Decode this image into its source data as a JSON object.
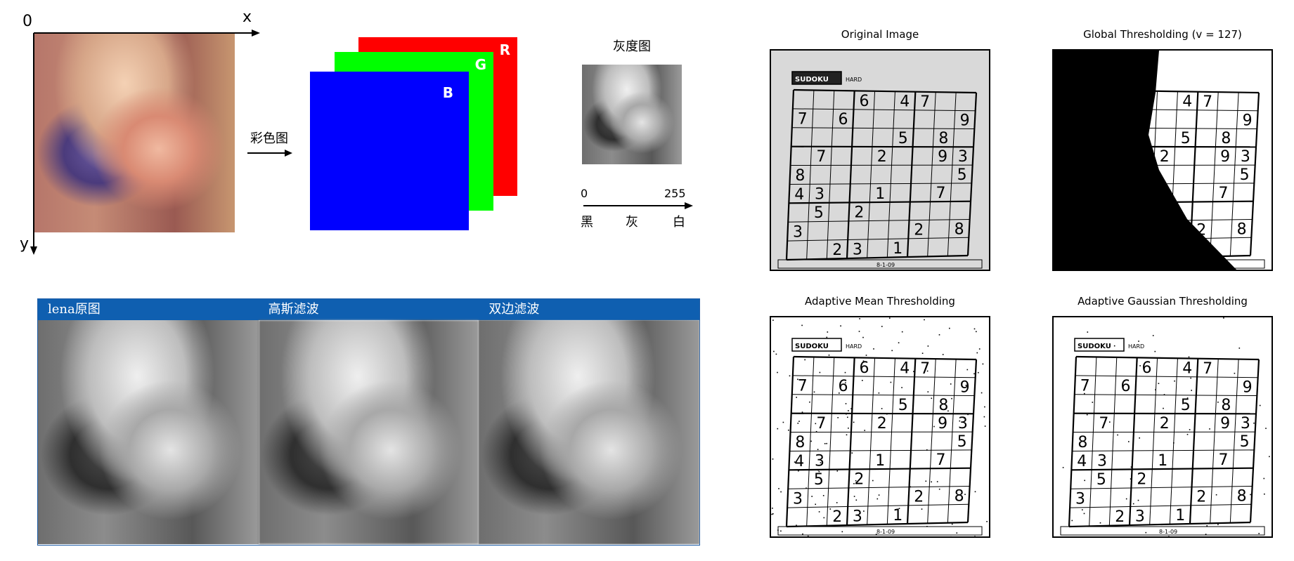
{
  "color_model": {
    "origin_label": "0",
    "x_label": "x",
    "y_label": "y",
    "arrow_label": "彩色图",
    "channels": [
      "R",
      "G",
      "B"
    ],
    "channel_colors": {
      "R": "#ff0000",
      "G": "#00ff00",
      "B": "#0000ff"
    }
  },
  "gray_model": {
    "title": "灰度图",
    "scale_min": "0",
    "scale_max": "255",
    "black_label": "黑",
    "gray_label": "灰",
    "white_label": "白"
  },
  "filters": {
    "accent_color": "#0f5fb0",
    "panels": [
      "lena原图",
      "高斯滤波",
      "双边滤波"
    ]
  },
  "thresholding": {
    "panels": [
      {
        "title": "Original Image",
        "style": "original"
      },
      {
        "title": "Global Thresholding (v = 127)",
        "style": "global"
      },
      {
        "title": "Adaptive Mean Thresholding",
        "style": "mean"
      },
      {
        "title": "Adaptive Gaussian Thresholding",
        "style": "gaussian"
      }
    ],
    "grid": [
      [
        "",
        "",
        "",
        "6",
        "",
        "4",
        "7",
        "",
        ""
      ],
      [
        "7",
        "",
        "6",
        "",
        "",
        "",
        "",
        "",
        "9"
      ],
      [
        "",
        "",
        "",
        "",
        "",
        "5",
        "",
        "8",
        ""
      ],
      [
        "",
        "7",
        "",
        "",
        "2",
        "",
        "",
        "9",
        "3"
      ],
      [
        "8",
        "",
        "",
        "",
        "",
        "",
        "",
        "",
        "5"
      ],
      [
        "4",
        "3",
        "",
        "",
        "1",
        "",
        "",
        "7",
        ""
      ],
      [
        "",
        "5",
        "",
        "2",
        "",
        "",
        "",
        "",
        ""
      ],
      [
        "3",
        "",
        "",
        "",
        "",
        "",
        "2",
        "",
        "8"
      ],
      [
        "",
        "",
        "2",
        "3",
        "",
        "1",
        "",
        "",
        ""
      ]
    ],
    "header_text": "SUDOKU",
    "level_text": "HARD",
    "footer_text": "8-1-09"
  }
}
